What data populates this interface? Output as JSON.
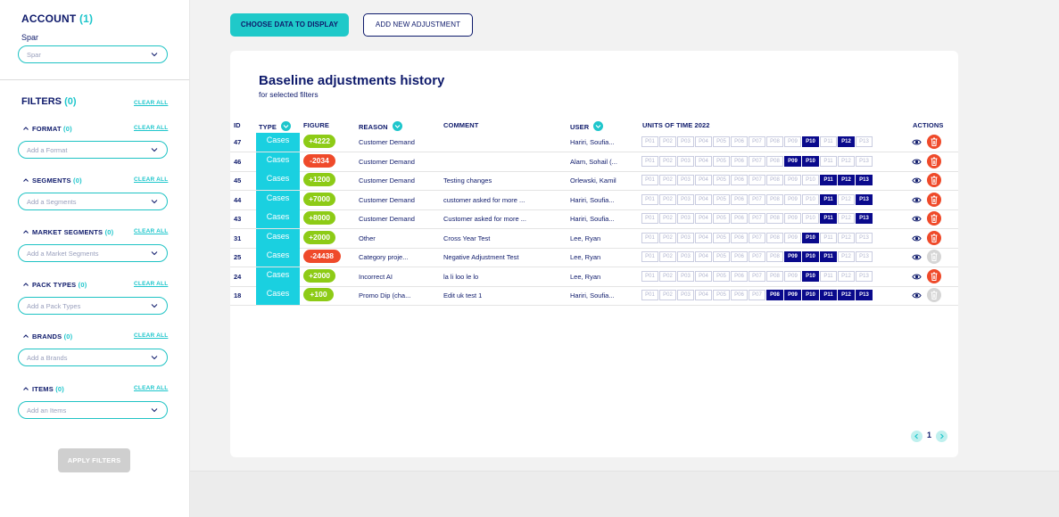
{
  "account": {
    "title": "ACCOUNT",
    "count": "(1)",
    "label": "Spar",
    "select_value": "Spar"
  },
  "filters": {
    "title": "FILTERS",
    "count": "(0)",
    "clear_all": "CLEAR ALL",
    "apply_label": "APPLY FILTERS",
    "groups": [
      {
        "label": "FORMAT",
        "count": "(0)",
        "placeholder": "Add a Format"
      },
      {
        "label": "SEGMENTS",
        "count": "(0)",
        "placeholder": "Add a Segments"
      },
      {
        "label": "MARKET SEGMENTS",
        "count": "(0)",
        "placeholder": "Add a Market Segments"
      },
      {
        "label": "PACK TYPES",
        "count": "(0)",
        "placeholder": "Add a Pack Types"
      },
      {
        "label": "BRANDS",
        "count": "(0)",
        "placeholder": "Add a Brands"
      },
      {
        "label": "ITEMS",
        "count": "(0)",
        "placeholder": "Add an Items"
      }
    ]
  },
  "toolbar": {
    "choose_label": "CHOOSE DATA TO DISPLAY",
    "add_label": "ADD NEW ADJUSTMENT"
  },
  "card": {
    "title": "Baseline adjustments history",
    "subtitle": "for selected filters"
  },
  "table": {
    "headers": {
      "id": "ID",
      "type": "TYPE",
      "figure": "FIGURE",
      "reason": "REASON",
      "comment": "COMMENT",
      "user": "USER",
      "units": "UNITS OF TIME 2022",
      "actions": "ACTIONS"
    },
    "period_labels": [
      "P01",
      "P02",
      "P03",
      "P04",
      "P05",
      "P06",
      "P07",
      "P08",
      "P09",
      "P10",
      "P11",
      "P12",
      "P13"
    ],
    "rows": [
      {
        "id": "47",
        "type": "Cases",
        "figure": "+4222",
        "reason": "Customer Demand",
        "comment": "",
        "user": "Hariri, Soufia...",
        "active": [
          "P10",
          "P12"
        ],
        "delete_enabled": true
      },
      {
        "id": "46",
        "type": "Cases",
        "figure": "-2034",
        "reason": "Customer Demand",
        "comment": "",
        "user": "Alam, Sohail (...",
        "active": [
          "P09",
          "P10"
        ],
        "delete_enabled": true
      },
      {
        "id": "45",
        "type": "Cases",
        "figure": "+1200",
        "reason": "Customer Demand",
        "comment": "Testing changes",
        "user": "Orlewski, Kamil",
        "active": [
          "P11",
          "P12",
          "P13"
        ],
        "delete_enabled": true
      },
      {
        "id": "44",
        "type": "Cases",
        "figure": "+7000",
        "reason": "Customer Demand",
        "comment": "customer asked for more ...",
        "user": "Hariri, Soufia...",
        "active": [
          "P11",
          "P13"
        ],
        "delete_enabled": true
      },
      {
        "id": "43",
        "type": "Cases",
        "figure": "+8000",
        "reason": "Customer Demand",
        "comment": "Customer asked for more ...",
        "user": "Hariri, Soufia...",
        "active": [
          "P11",
          "P13"
        ],
        "delete_enabled": true
      },
      {
        "id": "31",
        "type": "Cases",
        "figure": "+2000",
        "reason": "Other",
        "comment": "Cross Year Test",
        "user": "Lee, Ryan",
        "active": [
          "P10"
        ],
        "delete_enabled": true
      },
      {
        "id": "25",
        "type": "Cases",
        "figure": "-24438",
        "reason": "Category proje...",
        "comment": "Negative Adjustment Test",
        "user": "Lee, Ryan",
        "active": [
          "P09",
          "P10",
          "P11"
        ],
        "delete_enabled": false
      },
      {
        "id": "24",
        "type": "Cases",
        "figure": "+2000",
        "reason": "Incorrect AI",
        "comment": "la li loo le lo",
        "user": "Lee, Ryan",
        "active": [
          "P10"
        ],
        "delete_enabled": true
      },
      {
        "id": "18",
        "type": "Cases",
        "figure": "+100",
        "reason": "Promo Dip (cha...",
        "comment": "Edit uk test 1",
        "user": "Hariri, Soufia...",
        "active": [
          "P08",
          "P09",
          "P10",
          "P11",
          "P12",
          "P13"
        ],
        "delete_enabled": false
      }
    ]
  },
  "pagination": {
    "current_page": "1"
  },
  "colors": {
    "navy": "#0e1a6b",
    "teal": "#1ec6cc",
    "positive": "#8dcb16",
    "negative": "#ef4a2a",
    "period_active": "#0a0a8c"
  }
}
